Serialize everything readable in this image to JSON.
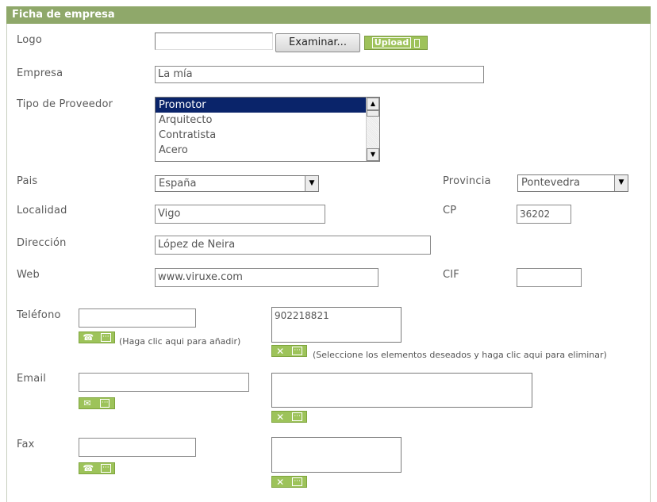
{
  "panel": {
    "title": "Ficha de empresa"
  },
  "logo": {
    "label": "Logo",
    "value": "",
    "browse_label": "Examinar...",
    "upload_label": "Upload"
  },
  "empresa": {
    "label": "Empresa",
    "value": "La mía"
  },
  "tipo_proveedor": {
    "label": "Tipo de Proveedor",
    "options": [
      "Promotor",
      "Arquitecto",
      "Contratista",
      "Acero"
    ],
    "selected": "Promotor"
  },
  "pais": {
    "label": "Pais",
    "value": "España"
  },
  "provincia": {
    "label": "Provincia",
    "value": "Pontevedra"
  },
  "localidad": {
    "label": "Localidad",
    "value": "Vigo"
  },
  "cp": {
    "label": "CP",
    "value": "36202"
  },
  "direccion": {
    "label": "Dirección",
    "value": "López de Neira"
  },
  "web": {
    "label": "Web",
    "value": "www.viruxe.com"
  },
  "cif": {
    "label": "CIF",
    "value": ""
  },
  "telefono": {
    "label": "Teléfono",
    "value": "",
    "add_hint": "(Haga clic aqui para añadir)",
    "list_value": "902218821",
    "remove_hint": "(Seleccione los elementos deseados y haga clic aqui para eliminar)"
  },
  "email": {
    "label": "Email",
    "value": "",
    "list_value": ""
  },
  "fax": {
    "label": "Fax",
    "value": "",
    "list_value": ""
  },
  "colors": {
    "title_bar": "#8fa86a",
    "button_green": "#9ec25a",
    "selection": "#0a246a"
  },
  "icons": [
    "phone-icon",
    "envelope-icon",
    "fax-icon",
    "remove-icon",
    "dots-icon"
  ]
}
